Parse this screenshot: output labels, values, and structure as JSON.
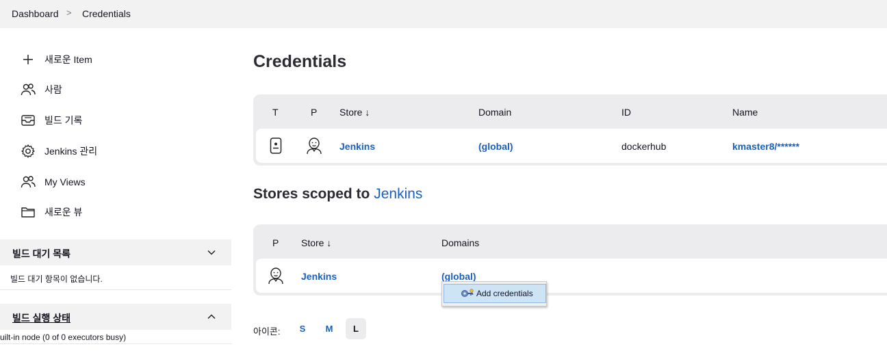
{
  "breadcrumb": {
    "home": "Dashboard",
    "separator": ">",
    "current": "Credentials"
  },
  "sidebar": {
    "items": [
      {
        "label": "새로운 Item",
        "icon": "plus-icon"
      },
      {
        "label": "사람",
        "icon": "people-icon"
      },
      {
        "label": "빌드 기록",
        "icon": "inbox-icon"
      },
      {
        "label": "Jenkins 관리",
        "icon": "gear-icon"
      },
      {
        "label": "My Views",
        "icon": "people-icon"
      },
      {
        "label": "새로운 뷰",
        "icon": "folder-icon"
      }
    ]
  },
  "build_queue": {
    "title": "빌드 대기 목록",
    "empty_message": "빌드 대기 항목이 없습니다."
  },
  "executor_status": {
    "title": "빌드 실행 상태",
    "node_text": "uilt-in node (0 of 0 executors busy)"
  },
  "main": {
    "title": "Credentials",
    "credentials_table": {
      "headers": [
        "T",
        "P",
        "Store ↓",
        "Domain",
        "ID",
        "Name"
      ],
      "rows": [
        {
          "store": "Jenkins",
          "domain": "(global)",
          "id": "dockerhub",
          "name": "kmaster8/******"
        }
      ]
    },
    "stores_heading": {
      "prefix": "Stores scoped to",
      "link": "Jenkins"
    },
    "stores_table": {
      "headers": [
        "P",
        "Store ↓",
        "Domains"
      ],
      "rows": [
        {
          "store": "Jenkins",
          "domain": "(global)"
        }
      ]
    },
    "context_menu": {
      "item": "Add credentials"
    },
    "icon_size": {
      "label": "아이콘:",
      "options": [
        "S",
        "M",
        "L"
      ],
      "selected": "L"
    }
  },
  "colors": {
    "link": "#1b5fbd",
    "panel": "#f2f2f3",
    "table_bg": "#ececee",
    "menu_highlight": "#cde4f7"
  }
}
